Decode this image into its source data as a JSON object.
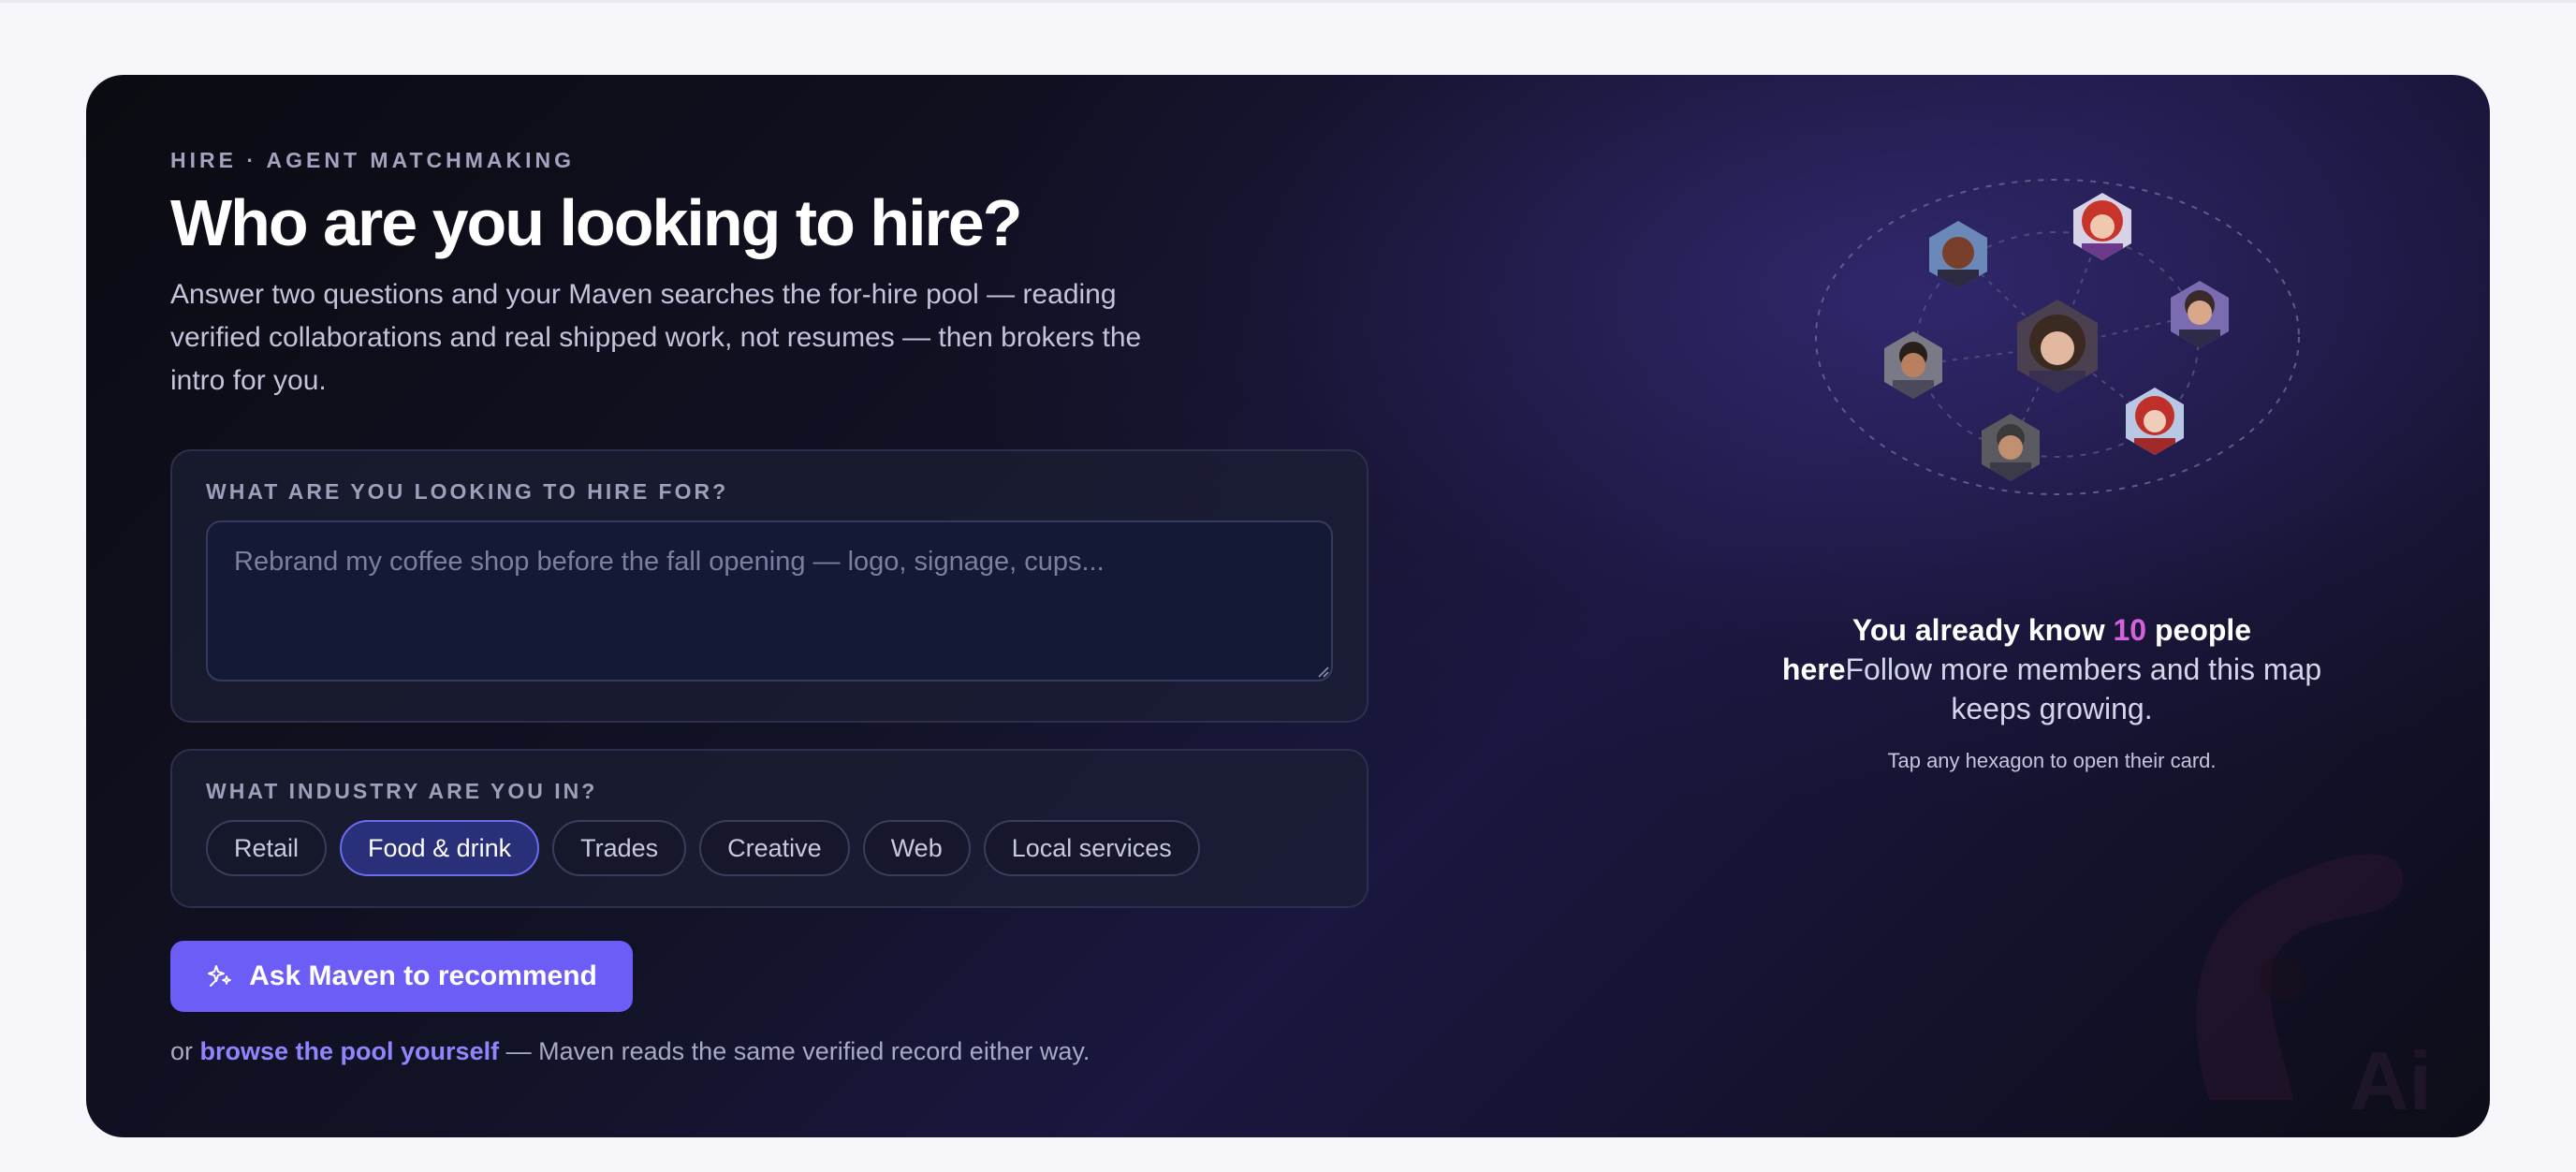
{
  "eyebrow": "HIRE · AGENT MATCHMAKING",
  "title": "Who are you looking to hire?",
  "subtitle": "Answer two questions and your Maven searches the for-hire pool — reading verified collaborations and real shipped work, not resumes — then brokers the intro for you.",
  "hire_for": {
    "label": "WHAT ARE YOU LOOKING TO HIRE FOR?",
    "placeholder": "Rebrand my coffee shop before the fall opening — logo, signage, cups..."
  },
  "industry": {
    "label": "WHAT INDUSTRY ARE YOU IN?",
    "options": [
      "Retail",
      "Food & drink",
      "Trades",
      "Creative",
      "Web",
      "Local services"
    ],
    "selected": "Food & drink"
  },
  "cta": {
    "label": "Ask Maven to recommend",
    "icon": "sparkle-icon"
  },
  "footer": {
    "prefix": "or",
    "link": "browse the pool yourself",
    "suffix": "— Maven reads the same verified record either way."
  },
  "network": {
    "lead": "You already know",
    "count": "10",
    "lead_end": "people here",
    "rest": "Follow more members and this map keeps growing.",
    "hint": "Tap any hexagon to open their card."
  },
  "colors": {
    "accent": "#6b5df6",
    "link": "#8f86ff",
    "count": "#d463d9",
    "chip_active_border": "#6b6cf0"
  }
}
